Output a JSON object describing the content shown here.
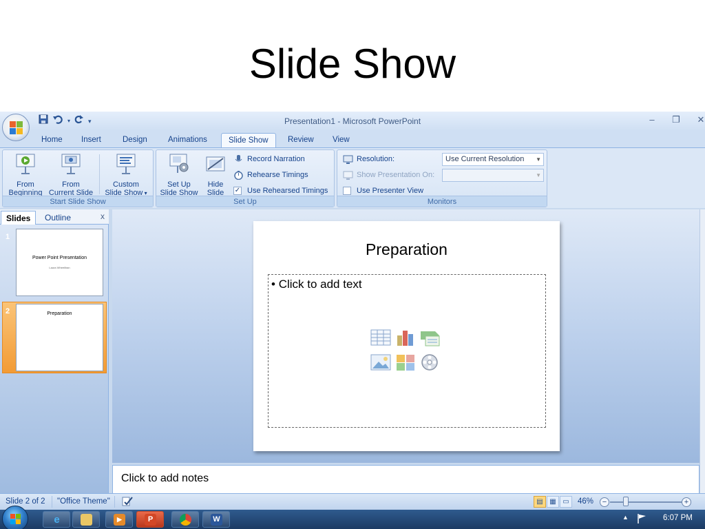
{
  "page_title": "Slide Show",
  "window": {
    "title": "Presentation1 - Microsoft PowerPoint",
    "minimize_icon": "minimize-icon",
    "restore_icon": "restore-icon",
    "close_icon": "close-icon"
  },
  "quick_access": {
    "save_icon": "save-icon",
    "undo_icon": "undo-icon",
    "redo_icon": "redo-icon",
    "customize_icon": "customize-qat-icon"
  },
  "tabs": [
    "Home",
    "Insert",
    "Design",
    "Animations",
    "Slide Show",
    "Review",
    "View"
  ],
  "active_tab": "Slide Show",
  "ribbon": {
    "start_group": {
      "label": "Start Slide Show",
      "from_beginning_l1": "From",
      "from_beginning_l2": "Beginning",
      "from_current_l1": "From",
      "from_current_l2": "Current Slide",
      "custom_l1": "Custom",
      "custom_l2": "Slide Show"
    },
    "setup_group": {
      "label": "Set Up",
      "setup_l1": "Set Up",
      "setup_l2": "Slide Show",
      "hide_l1": "Hide",
      "hide_l2": "Slide",
      "record_narration": "Record Narration",
      "rehearse_timings": "Rehearse Timings",
      "use_rehearsed": "Use Rehearsed Timings",
      "use_rehearsed_checked": true
    },
    "monitors_group": {
      "label": "Monitors",
      "resolution_label": "Resolution:",
      "resolution_value": "Use Current Resolution",
      "show_on_label": "Show Presentation On:",
      "show_on_value": "",
      "presenter_view": "Use Presenter View",
      "presenter_view_checked": false
    }
  },
  "left_pane": {
    "tab_slides": "Slides",
    "tab_outline": "Outline",
    "close": "x",
    "thumbnails": [
      {
        "number": "1",
        "title": "Power Point Presentation",
        "subtitle": "Laura Wheelihan"
      },
      {
        "number": "2",
        "title": "Preparation",
        "subtitle": ""
      }
    ],
    "selected": 2
  },
  "slide": {
    "title": "Preparation",
    "bullet": "•",
    "body_placeholder": "Click to add text"
  },
  "notes": {
    "placeholder": "Click to add notes"
  },
  "statusbar": {
    "slide_info": "Slide 2 of 2",
    "theme": "\"Office Theme\"",
    "zoom": "46%",
    "zoom_out": "−",
    "zoom_in": "+"
  },
  "taskbar": {
    "time": "6:07 PM",
    "apps": [
      "internet-explorer-icon",
      "file-explorer-icon",
      "media-player-icon",
      "powerpoint-icon",
      "chrome-icon",
      "word-icon"
    ]
  },
  "colors": {
    "accent": "#15428b",
    "ribbon_bg": "#dbe7f6",
    "selected_thumb": "#f29b35",
    "taskbar": "#1c3a63"
  }
}
